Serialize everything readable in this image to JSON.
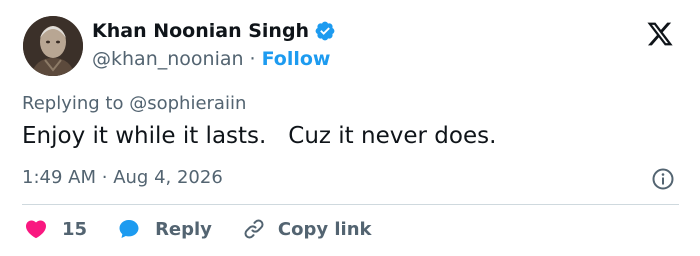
{
  "colors": {
    "text": "#0f1419",
    "muted": "#536471",
    "accent": "#1d9bf0",
    "like": "#f91880",
    "divider": "#cfd9de"
  },
  "author": {
    "display_name": "Khan Noonian Singh",
    "handle": "@khan_noonian",
    "separator": "·",
    "follow_label": "Follow",
    "verified_icon": "verified-badge-icon",
    "avatar_icon": "avatar"
  },
  "brand": {
    "icon": "x-logo-icon"
  },
  "tweet": {
    "replying_prefix": "Replying to",
    "replying_to": "@sophieraiin",
    "text": "Enjoy it while it lasts.   Cuz it never does.",
    "time": "1:49 AM",
    "meta_separator": "·",
    "date": "Aug 4, 2026",
    "info_icon": "info-icon"
  },
  "actions": {
    "like_count": "15",
    "like_icon": "heart-icon",
    "reply_label": "Reply",
    "reply_icon": "speech-bubble-icon",
    "copy_label": "Copy link",
    "copy_icon": "link-icon"
  }
}
